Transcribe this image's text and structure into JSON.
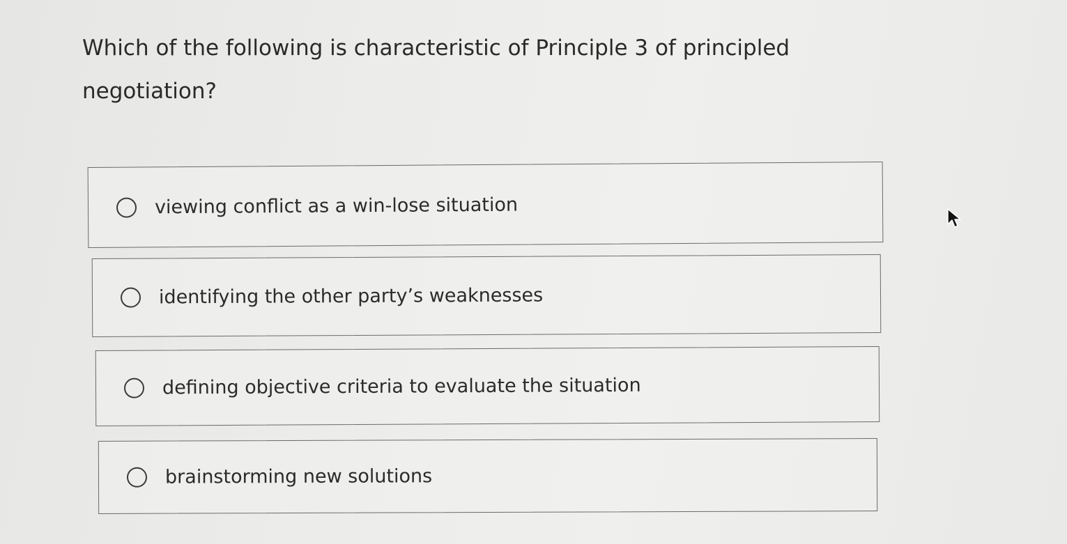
{
  "question": {
    "text": "Which of the following is characteristic of Principle 3 of principled negotiation?"
  },
  "options": [
    {
      "label": "viewing conflict as a win-lose situation",
      "selected": false
    },
    {
      "label": "identifying the other party’s weaknesses",
      "selected": false
    },
    {
      "label": "defining objective criteria to evaluate the situation",
      "selected": false
    },
    {
      "label": "brainstorming new solutions",
      "selected": false
    }
  ],
  "icons": {
    "radio": "radio-unselected-icon",
    "cursor": "mouse-pointer-icon"
  }
}
